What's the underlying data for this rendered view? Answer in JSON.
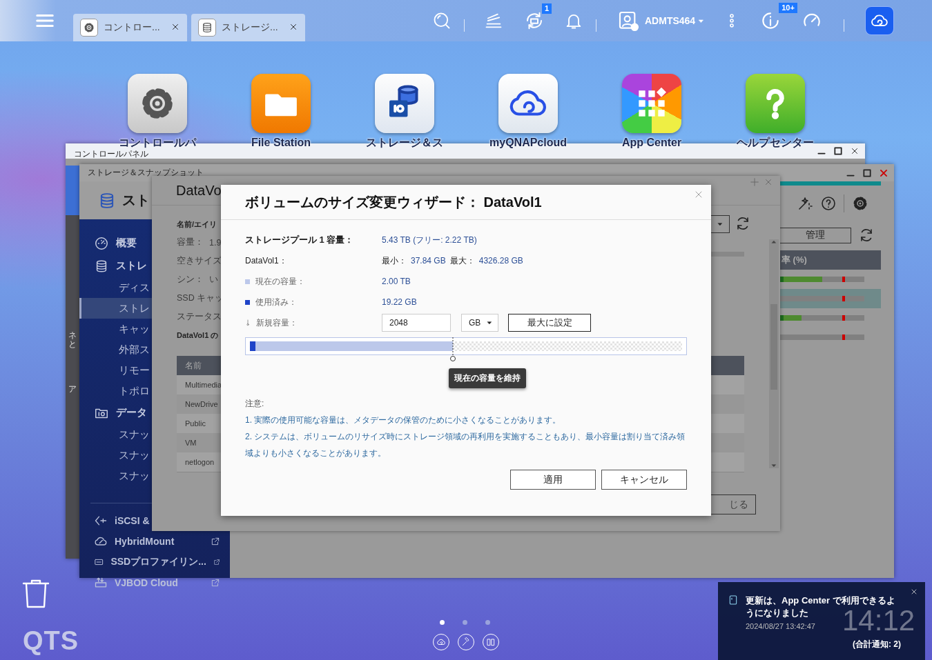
{
  "topbar": {
    "tabs": [
      {
        "kind": "settings",
        "label": "コントロー..."
      },
      {
        "kind": "storage",
        "label": "ストレージ..."
      }
    ],
    "sync_badge": "1",
    "user": "ADMTS464",
    "info_badge": "10+"
  },
  "desktop_icons": [
    {
      "kind": "settings",
      "label": "コントロールパ"
    },
    {
      "kind": "files",
      "label": "File Station"
    },
    {
      "kind": "storage",
      "label": "ストレージ＆ス"
    },
    {
      "kind": "cloud",
      "label": "myQNAPcloud"
    },
    {
      "kind": "apps",
      "label": "App Center"
    },
    {
      "kind": "help",
      "label": "ヘルプセンター"
    }
  ],
  "control_panel": {
    "title": "コントロールパネル",
    "side_texts": [
      "ネと",
      "ア"
    ]
  },
  "storage_window": {
    "title": "ストレージ＆スナップショット",
    "app_name": "スト",
    "sidebar": [
      {
        "kind": "overview",
        "label": "概要",
        "selected": false
      },
      {
        "kind": "storage",
        "label": "ストレ",
        "selected": false
      },
      {
        "kind": "sub",
        "label": "ディス",
        "selected": false
      },
      {
        "kind": "sub",
        "label": "ストレ",
        "selected": true
      },
      {
        "kind": "sub",
        "label": "キャッ",
        "selected": false
      },
      {
        "kind": "sub",
        "label": "外部ス",
        "selected": false
      },
      {
        "kind": "sub",
        "label": "リモー",
        "selected": false
      },
      {
        "kind": "sub",
        "label": "トポロ",
        "selected": false
      },
      {
        "kind": "protection",
        "label": "データ",
        "selected": false
      },
      {
        "kind": "sub",
        "label": "スナッ",
        "selected": false
      },
      {
        "kind": "sub",
        "label": "スナッ",
        "selected": false
      },
      {
        "kind": "sub",
        "label": "スナッ",
        "selected": false
      }
    ],
    "tools": [
      {
        "kind": "iscsi",
        "label": "iSCSI &"
      },
      {
        "kind": "hybrid",
        "label": "HybridMount"
      },
      {
        "kind": "ssd",
        "label": "SSDプロファイリン..."
      },
      {
        "kind": "vjbod",
        "label": "VJBOD Cloud"
      }
    ],
    "manage_button": "管理",
    "column_header": "率 (%)",
    "usage_rows": [
      {
        "level": 0.5,
        "selected": false
      },
      {
        "level": 0,
        "selected": true
      },
      {
        "level": 0.25,
        "selected": false
      },
      {
        "level": 0,
        "selected": false
      }
    ]
  },
  "volume_window": {
    "title": "DataVo",
    "fields": [
      {
        "kind": "heading",
        "label": "名前/エイリ"
      },
      {
        "kind": "pair",
        "label": "容量：",
        "value": "1.9"
      },
      {
        "kind": "pair",
        "label": "空きサイズ"
      },
      {
        "kind": "pair",
        "label": "シン：",
        "value": "い"
      },
      {
        "kind": "pair",
        "label": "SSD キャッ"
      },
      {
        "kind": "pair",
        "label": "ステータス"
      },
      {
        "kind": "heading",
        "label": "DataVol1 の"
      }
    ],
    "table": {
      "columns": [
        "名前"
      ],
      "rows": [
        "Multimedia",
        "NewDrive",
        "Public",
        "VM",
        "netlogon"
      ]
    },
    "close_button": "じる"
  },
  "dialog": {
    "title": "ボリュームのサイズ変更ウィザード： DataVol1",
    "pool_label": "ストレージプール 1 容量：",
    "pool_value": "5.43 TB (フリー: 2.22 TB)",
    "volume_label": "DataVol1：",
    "min_label": "最小：",
    "min_value": "37.84 GB",
    "max_label": "最大：",
    "max_value": "4326.28 GB",
    "current_label": "現在の容量：",
    "current_value": "2.00 TB",
    "used_label": "使用済み：",
    "used_value": "19.22 GB",
    "new_label": "新規容量：",
    "new_value": "2048",
    "unit": "GB",
    "max_button": "最大に設定",
    "capacity_bar": {
      "current": {
        "level": 0.47
      },
      "used": {
        "level": 0.012
      }
    },
    "tooltip": "現在の容量を維持",
    "notes_title": "注意:",
    "notes": [
      "1. 実際の使用可能な容量は、メタデータの保管のために小さくなることがあります。",
      "2. システムは、ボリュームのリサイズ時にストレージ領域の再利用を実施することもあり、最小容量は割り当て済み領域よりも小さくなることがあります。"
    ],
    "buttons": [
      "適用",
      "キャンセル"
    ]
  },
  "clock": "14:12",
  "notification": {
    "message": "更新は、App Center で利用できるようになりました",
    "time": "2024/08/27 13:42:47",
    "total": "(合計通知: 2)"
  },
  "page_dots": [
    {
      "selected": true
    },
    {
      "selected": false
    },
    {
      "selected": false
    }
  ],
  "logo": "QTS"
}
